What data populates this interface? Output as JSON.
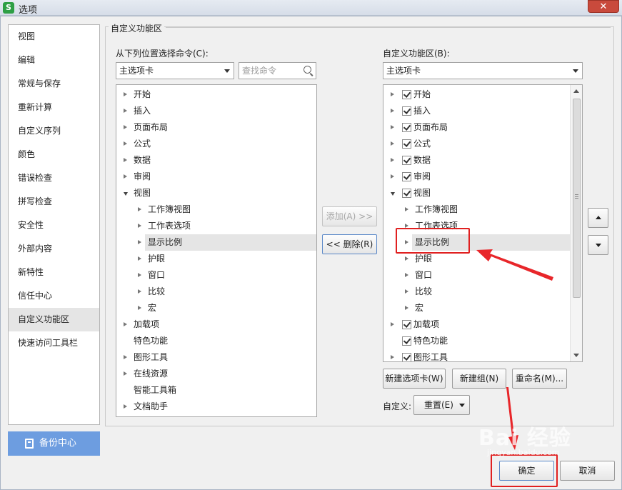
{
  "window": {
    "title": "选项",
    "app_icon": "S",
    "close_label": "✕"
  },
  "sidebar": {
    "items": [
      {
        "label": "视图"
      },
      {
        "label": "编辑"
      },
      {
        "label": "常规与保存"
      },
      {
        "label": "重新计算"
      },
      {
        "label": "自定义序列"
      },
      {
        "label": "颜色"
      },
      {
        "label": "错误检查"
      },
      {
        "label": "拼写检查"
      },
      {
        "label": "安全性"
      },
      {
        "label": "外部内容"
      },
      {
        "label": "新特性"
      },
      {
        "label": "信任中心"
      },
      {
        "label": "自定义功能区",
        "active": true
      },
      {
        "label": "快速访问工具栏"
      }
    ],
    "backup_label": "备份中心"
  },
  "group": {
    "title": "自定义功能区"
  },
  "left": {
    "label": "从下列位置选择命令(C):",
    "select_value": "主选项卡",
    "search_placeholder": "查找命令",
    "tree": [
      {
        "text": "开始",
        "level": 0,
        "expander": "closed"
      },
      {
        "text": "插入",
        "level": 0,
        "expander": "closed"
      },
      {
        "text": "页面布局",
        "level": 0,
        "expander": "closed"
      },
      {
        "text": "公式",
        "level": 0,
        "expander": "closed"
      },
      {
        "text": "数据",
        "level": 0,
        "expander": "closed"
      },
      {
        "text": "审阅",
        "level": 0,
        "expander": "closed"
      },
      {
        "text": "视图",
        "level": 0,
        "expander": "open"
      },
      {
        "text": "工作簿视图",
        "level": 1,
        "expander": "closed"
      },
      {
        "text": "工作表选项",
        "level": 1,
        "expander": "closed"
      },
      {
        "text": "显示比例",
        "level": 1,
        "expander": "closed",
        "selected": true
      },
      {
        "text": "护眼",
        "level": 1,
        "expander": "closed"
      },
      {
        "text": "窗口",
        "level": 1,
        "expander": "closed"
      },
      {
        "text": "比较",
        "level": 1,
        "expander": "closed"
      },
      {
        "text": "宏",
        "level": 1,
        "expander": "closed"
      },
      {
        "text": "加载项",
        "level": 0,
        "expander": "closed"
      },
      {
        "text": "特色功能",
        "level": 0,
        "expander": "none"
      },
      {
        "text": "图形工具",
        "level": 0,
        "expander": "closed"
      },
      {
        "text": "在线资源",
        "level": 0,
        "expander": "closed"
      },
      {
        "text": "智能工具箱",
        "level": 0,
        "expander": "none"
      },
      {
        "text": "文档助手",
        "level": 0,
        "expander": "closed"
      }
    ]
  },
  "middle": {
    "add_label": "添加(A) >>",
    "remove_label": "<< 删除(R)"
  },
  "right": {
    "label": "自定义功能区(B):",
    "select_value": "主选项卡",
    "tree": [
      {
        "text": "开始",
        "level": 0,
        "expander": "closed",
        "check": true
      },
      {
        "text": "插入",
        "level": 0,
        "expander": "closed",
        "check": true
      },
      {
        "text": "页面布局",
        "level": 0,
        "expander": "closed",
        "check": true
      },
      {
        "text": "公式",
        "level": 0,
        "expander": "closed",
        "check": true
      },
      {
        "text": "数据",
        "level": 0,
        "expander": "closed",
        "check": true
      },
      {
        "text": "审阅",
        "level": 0,
        "expander": "closed",
        "check": true
      },
      {
        "text": "视图",
        "level": 0,
        "expander": "open",
        "check": true
      },
      {
        "text": "工作簿视图",
        "level": 1,
        "expander": "closed"
      },
      {
        "text": "工作表选项",
        "level": 1,
        "expander": "closed"
      },
      {
        "text": "显示比例",
        "level": 1,
        "expander": "closed",
        "selected": true
      },
      {
        "text": "护眼",
        "level": 1,
        "expander": "closed"
      },
      {
        "text": "窗口",
        "level": 1,
        "expander": "closed"
      },
      {
        "text": "比较",
        "level": 1,
        "expander": "closed"
      },
      {
        "text": "宏",
        "level": 1,
        "expander": "closed"
      },
      {
        "text": "加载项",
        "level": 0,
        "expander": "closed",
        "check": true
      },
      {
        "text": "特色功能",
        "level": 0,
        "expander": "none",
        "check": true
      },
      {
        "text": "图形工具",
        "level": 0,
        "expander": "closed",
        "check": true
      }
    ],
    "new_tab_label": "新建选项卡(W)",
    "new_group_label": "新建组(N)",
    "rename_label": "重命名(M)...",
    "customize_label": "自定义:",
    "reset_label": "重置(E)"
  },
  "footer": {
    "ok_label": "确定",
    "cancel_label": "取消"
  },
  "watermark": {
    "text": "Bai 经验",
    "sub": "jingyan.baidu.com"
  },
  "colors": {
    "highlight": "#e02020",
    "backup_bg": "#6d9de0"
  }
}
